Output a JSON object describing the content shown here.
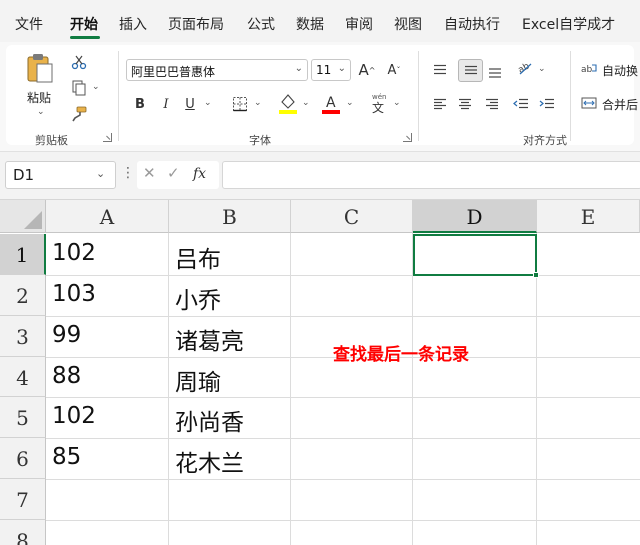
{
  "menu": {
    "tabs": [
      "文件",
      "开始",
      "插入",
      "页面布局",
      "公式",
      "数据",
      "审阅",
      "视图",
      "自动执行",
      "Excel自学成才"
    ],
    "active_index": 1
  },
  "ribbon": {
    "clipboard": {
      "paste_label": "粘贴",
      "group_label": "剪贴板"
    },
    "font": {
      "font_name": "阿里巴巴普惠体",
      "font_size": "11",
      "bold": "B",
      "italic": "I",
      "underline": "U",
      "grow": "A^",
      "shrink": "Aˇ",
      "font_color_glyph": "A",
      "phonetic_glyph": "文",
      "group_label": "字体",
      "fill_color": "#ffff00",
      "font_color": "#ff0000"
    },
    "alignment": {
      "wrap_text_label": "自动换",
      "merge_label": "合并后",
      "group_label": "对齐方式"
    }
  },
  "formula_bar": {
    "name_box": "D1",
    "fx_label": "fx",
    "formula": ""
  },
  "sheet": {
    "columns": [
      "A",
      "B",
      "C",
      "D",
      "E"
    ],
    "rows": [
      "1",
      "2",
      "3",
      "4",
      "5",
      "6",
      "7",
      "8"
    ],
    "selected_cell": "D1",
    "data": [
      [
        "102",
        "吕布"
      ],
      [
        "103",
        "小乔"
      ],
      [
        "99",
        "诸葛亮"
      ],
      [
        "88",
        "周瑜"
      ],
      [
        "102",
        "孙尚香"
      ],
      [
        "85",
        "花木兰"
      ]
    ],
    "note": "查找最后一条记录",
    "note_color": "#ff0000",
    "accent_color": "#107c41"
  }
}
